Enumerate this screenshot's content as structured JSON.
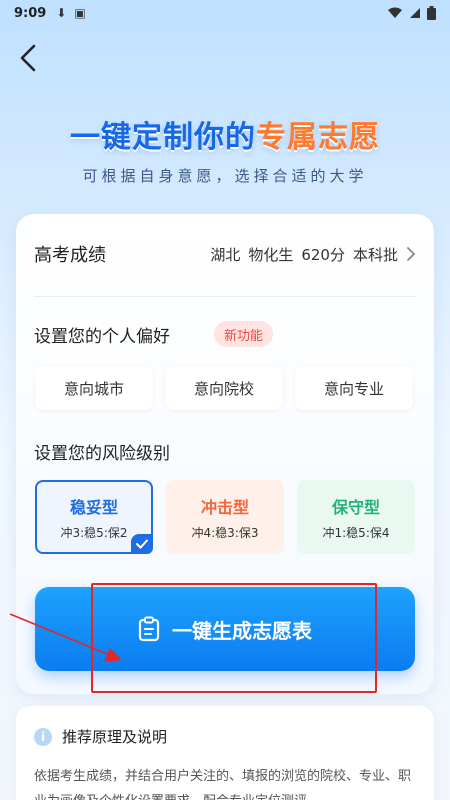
{
  "status_bar": {
    "time": "9:09"
  },
  "hero": {
    "title_main": "一键定制你的",
    "title_accent": "专属志愿",
    "subtitle": "可根据自身意愿，选择合适的大学"
  },
  "score": {
    "label": "高考成绩",
    "province": "湖北",
    "subjects": "物化生",
    "points": "620分",
    "batch": "本科批"
  },
  "preferences": {
    "title": "设置您的个人偏好",
    "badge": "新功能",
    "options": [
      "意向城市",
      "意向院校",
      "意向专业"
    ]
  },
  "risk": {
    "title": "设置您的风险级别",
    "levels": [
      {
        "name": "稳妥型",
        "ratio": "冲3:稳5:保2",
        "selected": true,
        "color": "#1f6de3"
      },
      {
        "name": "冲击型",
        "ratio": "冲4:稳3:保3",
        "selected": false,
        "color": "#f2663a"
      },
      {
        "name": "保守型",
        "ratio": "冲1:稳5:保4",
        "selected": false,
        "color": "#21b27a"
      }
    ]
  },
  "generate_button": {
    "label": "一键生成志愿表"
  },
  "info": {
    "title": "推荐原理及说明",
    "text": "依据考生成绩，并结合用户关注的、填报的浏览的院校、专业、职业为画像及个性化设置要求，配合专业定位测评"
  },
  "annotation_colors": {
    "highlight": "#e32626"
  }
}
